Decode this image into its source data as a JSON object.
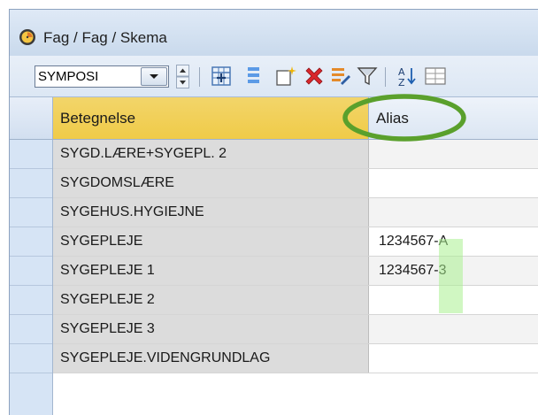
{
  "window": {
    "title": "Fag / Fag / Skema"
  },
  "toolbar": {
    "combo_value": "SYMPOSI",
    "icons": [
      "add-table-icon",
      "list-icon",
      "new-item-icon",
      "delete-icon",
      "edit-list-icon",
      "filter-icon",
      "sort-az-icon",
      "grid-view-icon"
    ]
  },
  "grid": {
    "columns": [
      "Betegnelse",
      "Alias"
    ],
    "rows": [
      {
        "betegnelse": "SYGD.LÆRE+SYGEPL. 2",
        "alias": ""
      },
      {
        "betegnelse": "SYGDOMSLÆRE",
        "alias": ""
      },
      {
        "betegnelse": "SYGEHUS.HYGIEJNE",
        "alias": ""
      },
      {
        "betegnelse": "SYGEPLEJE",
        "alias": "1234567-A"
      },
      {
        "betegnelse": "SYGEPLEJE 1",
        "alias": "1234567-3"
      },
      {
        "betegnelse": "SYGEPLEJE 2",
        "alias": ""
      },
      {
        "betegnelse": "SYGEPLEJE 3",
        "alias": ""
      },
      {
        "betegnelse": "SYGEPLEJE.VIDENGRUNDLAG",
        "alias": ""
      }
    ]
  },
  "colors": {
    "highlight_ellipse": "#5aa02c",
    "highlight_text": "#a9f08f",
    "sorted_header": "#f0cb48"
  }
}
